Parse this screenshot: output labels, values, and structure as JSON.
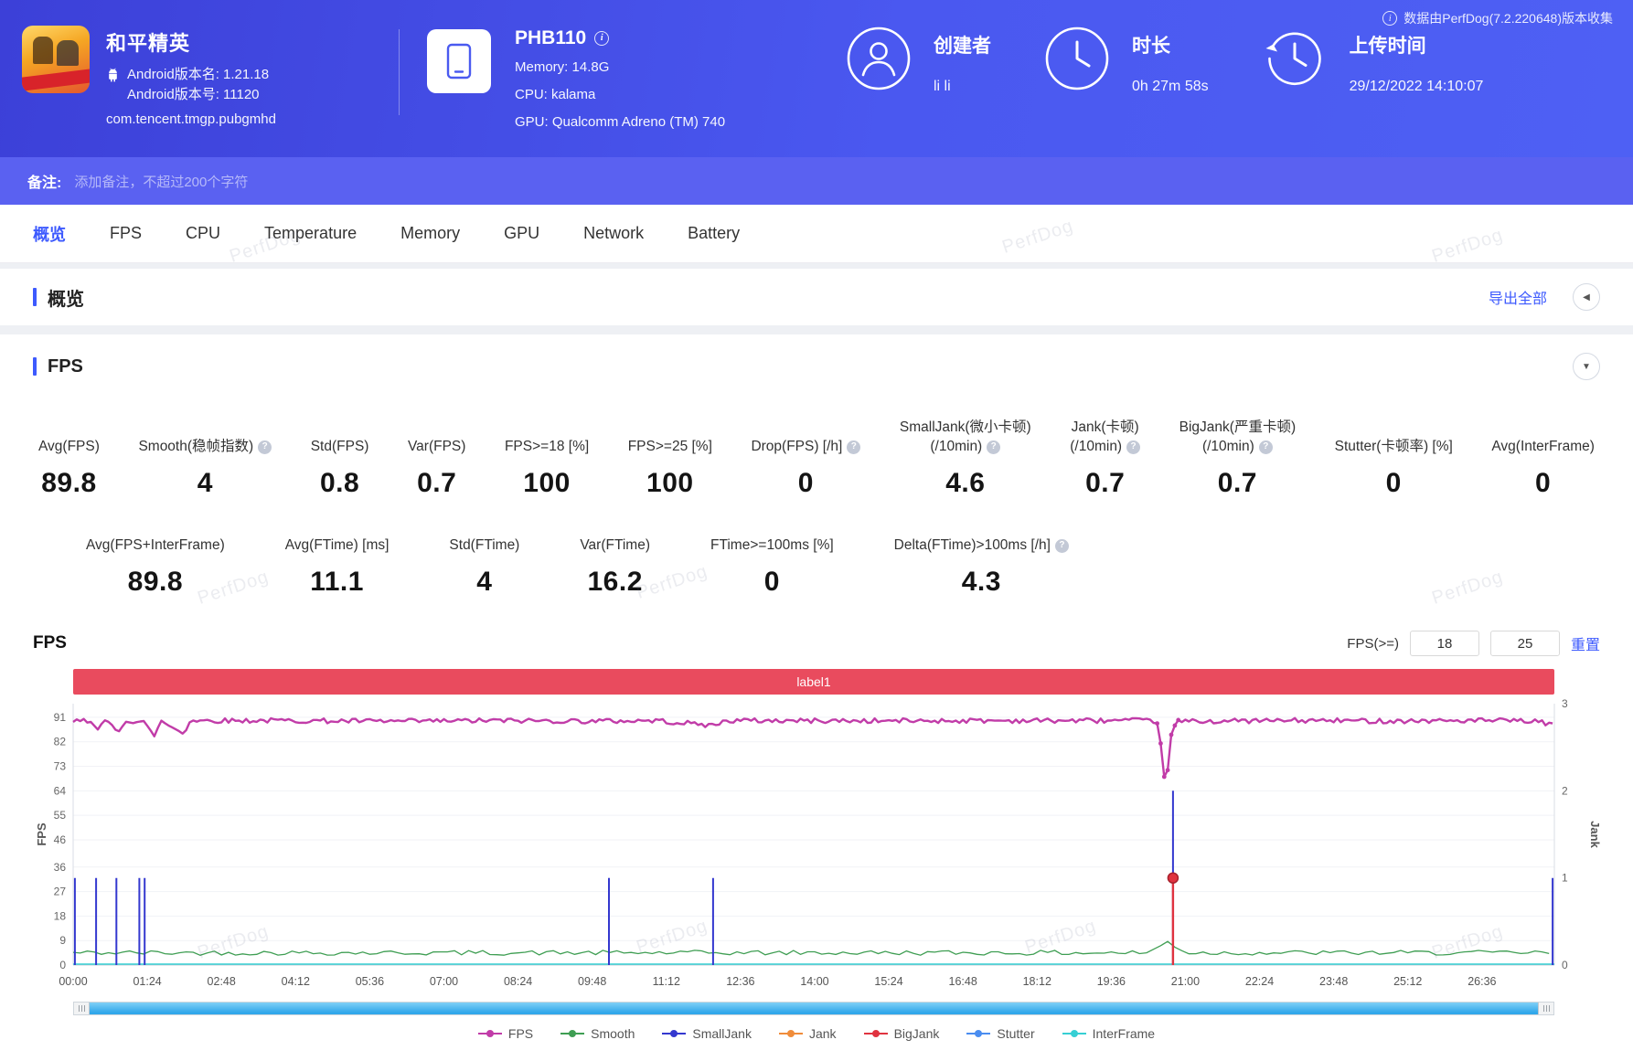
{
  "watermark": "PerfDog",
  "header": {
    "collect_note": "数据由PerfDog(7.2.220648)版本收集",
    "app": {
      "name": "和平精英",
      "version_name": "Android版本名: 1.21.18",
      "version_code": "Android版本号: 11120",
      "package": "com.tencent.tmgp.pubgmhd"
    },
    "device": {
      "model": "PHB110",
      "memory": "Memory: 14.8G",
      "cpu": "CPU: kalama",
      "gpu": "GPU: Qualcomm Adreno (TM) 740"
    },
    "creator": {
      "label": "创建者",
      "value": "li li"
    },
    "duration": {
      "label": "时长",
      "value": "0h 27m 58s"
    },
    "upload": {
      "label": "上传时间",
      "value": "29/12/2022 14:10:07"
    }
  },
  "remark": {
    "label": "备注:",
    "placeholder": "添加备注，不超过200个字符"
  },
  "tabs": [
    {
      "id": "overview",
      "label": "概览",
      "active": true
    },
    {
      "id": "fps",
      "label": "FPS",
      "active": false
    },
    {
      "id": "cpu",
      "label": "CPU",
      "active": false
    },
    {
      "id": "temperature",
      "label": "Temperature",
      "active": false
    },
    {
      "id": "memory",
      "label": "Memory",
      "active": false
    },
    {
      "id": "gpu",
      "label": "GPU",
      "active": false
    },
    {
      "id": "network",
      "label": "Network",
      "active": false
    },
    {
      "id": "battery",
      "label": "Battery",
      "active": false
    }
  ],
  "overview": {
    "title": "概览",
    "export_all": "导出全部"
  },
  "fps_card": {
    "title": "FPS",
    "metrics_primary": [
      {
        "id": "avg-fps",
        "line1": "Avg(FPS)",
        "value": "89.8"
      },
      {
        "id": "smooth",
        "line1": "Smooth(稳帧指数)",
        "help": true,
        "value": "4"
      },
      {
        "id": "std-fps",
        "line1": "Std(FPS)",
        "value": "0.8"
      },
      {
        "id": "var-fps",
        "line1": "Var(FPS)",
        "value": "0.7"
      },
      {
        "id": "fps-ge-18",
        "line1": "FPS>=18 [%]",
        "value": "100"
      },
      {
        "id": "fps-ge-25",
        "line1": "FPS>=25 [%]",
        "value": "100"
      },
      {
        "id": "drop-fps",
        "line1": "Drop(FPS) [/h]",
        "help": true,
        "value": "0"
      },
      {
        "id": "small-jank",
        "line1": "SmallJank(微小卡顿)",
        "line2": "(/10min)",
        "help": true,
        "value": "4.6"
      },
      {
        "id": "jank",
        "line1": "Jank(卡顿)",
        "line2": "(/10min)",
        "help": true,
        "value": "0.7"
      },
      {
        "id": "big-jank",
        "line1": "BigJank(严重卡顿)",
        "line2": "(/10min)",
        "help": true,
        "value": "0.7"
      },
      {
        "id": "stutter",
        "line1": "Stutter(卡顿率) [%]",
        "value": "0"
      },
      {
        "id": "avg-interframe",
        "line1": "Avg(InterFrame)",
        "value": "0"
      }
    ],
    "metrics_secondary": [
      {
        "id": "avg-fps-interframe",
        "line1": "Avg(FPS+InterFrame)",
        "value": "89.8"
      },
      {
        "id": "avg-ftime",
        "line1": "Avg(FTime) [ms]",
        "value": "11.1"
      },
      {
        "id": "std-ftime",
        "line1": "Std(FTime)",
        "value": "4"
      },
      {
        "id": "var-ftime",
        "line1": "Var(FTime)",
        "value": "16.2"
      },
      {
        "id": "ftime-ge-100ms",
        "line1": "FTime>=100ms [%]",
        "value": "0"
      },
      {
        "id": "delta-ftime",
        "line1": "Delta(FTime)>100ms [/h]",
        "help": true,
        "value": "4.3"
      }
    ],
    "chart_controls": {
      "title": "FPS",
      "threshold_label": "FPS(>=)",
      "threshold1": "18",
      "threshold2": "25",
      "reset": "重置"
    }
  },
  "chart_data": {
    "type": "line",
    "title": "FPS",
    "annotation": "label1",
    "x_ticks": [
      "00:00",
      "01:24",
      "02:48",
      "04:12",
      "05:36",
      "07:00",
      "08:24",
      "09:48",
      "11:12",
      "12:36",
      "14:00",
      "15:24",
      "16:48",
      "18:12",
      "19:36",
      "21:00",
      "22:24",
      "23:48",
      "25:12",
      "26:36"
    ],
    "tick_interval_sec": 84,
    "duration_sec": 1678,
    "y_left": {
      "label": "FPS",
      "ticks": [
        0,
        9,
        18,
        27,
        36,
        46,
        55,
        64,
        73,
        82,
        91
      ],
      "max": 96
    },
    "y_right": {
      "label": "Jank",
      "ticks": [
        0,
        1,
        2,
        3
      ],
      "max": 3
    },
    "legend": [
      "FPS",
      "Smooth",
      "SmallJank",
      "Jank",
      "BigJank",
      "Stutter",
      "InterFrame"
    ],
    "series_colors": {
      "FPS": "#c13ca8",
      "Smooth": "#3f9e53",
      "SmallJank": "#3438cf",
      "Jank": "#f08c3a",
      "BigJank": "#e03340",
      "Stutter": "#4a8df0",
      "InterFrame": "#36cfd4"
    },
    "fps_line": {
      "baseline": 89.8,
      "keypoints": [
        [
          0,
          88.5
        ],
        [
          4,
          90
        ],
        [
          22,
          89.5
        ],
        [
          30,
          86.5
        ],
        [
          34,
          90
        ],
        [
          52,
          85.5
        ],
        [
          58,
          89.8
        ],
        [
          80,
          89.5
        ],
        [
          92,
          83.5
        ],
        [
          98,
          89.8
        ],
        [
          126,
          85
        ],
        [
          132,
          89.8
        ],
        [
          240,
          89.8
        ],
        [
          360,
          89.5
        ],
        [
          480,
          89.8
        ],
        [
          600,
          89.6
        ],
        [
          660,
          89.8
        ],
        [
          725,
          88
        ],
        [
          740,
          89.8
        ],
        [
          900,
          89.7
        ],
        [
          1050,
          89.8
        ],
        [
          1200,
          89.8
        ],
        [
          1228,
          89.5
        ],
        [
          1234,
          76
        ],
        [
          1238,
          64
        ],
        [
          1243,
          83
        ],
        [
          1250,
          89.5
        ],
        [
          1380,
          89.8
        ],
        [
          1500,
          89.7
        ],
        [
          1596,
          89.8
        ],
        [
          1650,
          89.6
        ],
        [
          1678,
          88.5
        ]
      ]
    },
    "smooth_line": {
      "baseline": 4.5
    },
    "interframe_line": {
      "baseline": 0
    },
    "smalljank_events": [
      [
        2,
        1
      ],
      [
        26,
        1
      ],
      [
        49,
        1
      ],
      [
        75,
        1
      ],
      [
        81,
        1
      ],
      [
        607,
        1
      ],
      [
        725,
        1
      ],
      [
        1246,
        2
      ],
      [
        1676,
        1
      ]
    ],
    "jank_events": [],
    "bigjank_events": [
      [
        1246,
        1
      ]
    ],
    "stutter_events": []
  }
}
